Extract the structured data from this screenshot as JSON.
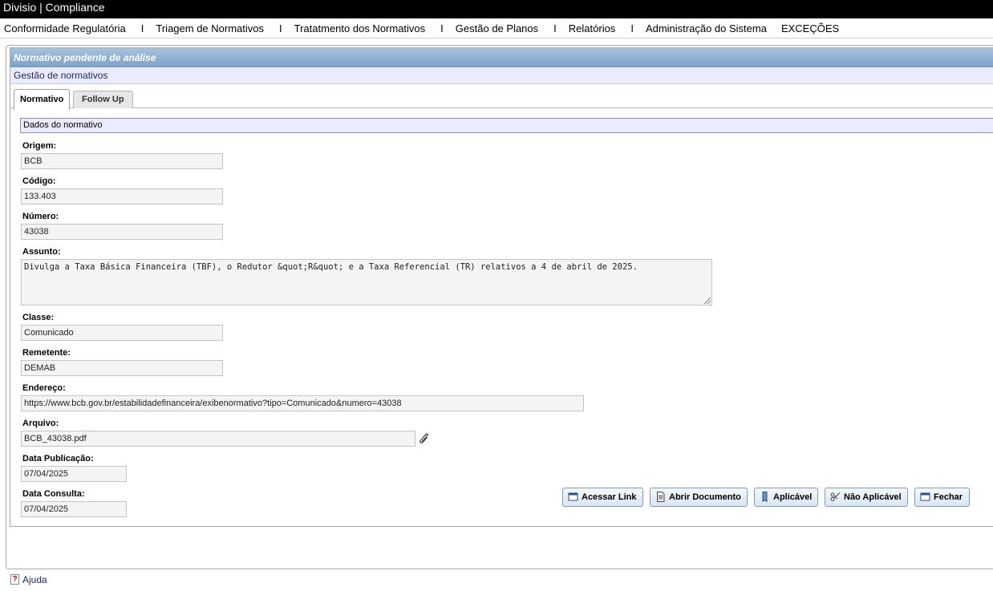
{
  "app": {
    "title": "Divisio | Compliance"
  },
  "menu": {
    "items": [
      "Conformidade Regulatória",
      "Triagem de Normativos",
      "Tratatmento dos Normativos",
      "Gestão de Planos",
      "Relatórios",
      "Administração do Sistema",
      "EXCEÇÕES"
    ],
    "separator": "I"
  },
  "panel": {
    "title": "Normativo pendente de análise",
    "subtitle": "Gestão de normativos"
  },
  "tabs": [
    {
      "label": "Normativo",
      "active": true
    },
    {
      "label": "Follow Up",
      "active": false
    }
  ],
  "section": {
    "title": "Dados do normativo"
  },
  "form": {
    "origem": {
      "label": "Origem:",
      "value": "BCB"
    },
    "codigo": {
      "label": "Código:",
      "value": "133.403"
    },
    "numero": {
      "label": "Número:",
      "value": "43038"
    },
    "assunto": {
      "label": "Assunto:",
      "value": "Divulga a Taxa Básica Financeira (TBF), o Redutor &quot;R&quot; e a Taxa Referencial (TR) relativos a 4 de abril de 2025."
    },
    "classe": {
      "label": "Classe:",
      "value": "Comunicado"
    },
    "remetente": {
      "label": "Remetente:",
      "value": "DEMAB"
    },
    "endereco": {
      "label": "Endereço:",
      "value": "https://www.bcb.gov.br/estabilidadefinanceira/exibenormativo?tipo=Comunicado&numero=43038"
    },
    "arquivo": {
      "label": "Arquivo:",
      "value": "BCB_43038.pdf",
      "icon": "paperclip-icon"
    },
    "data_publicacao": {
      "label": "Data Publicação:",
      "value": "07/04/2025"
    },
    "data_consulta": {
      "label": "Data Consulta:",
      "value": "07/04/2025"
    }
  },
  "buttons": {
    "acessar_link": {
      "label": "Acessar Link",
      "icon": "window-icon"
    },
    "abrir_documento": {
      "label": "Abrir Documento",
      "icon": "document-icon"
    },
    "aplicavel": {
      "label": "Aplicável",
      "icon": "bookmark-icon"
    },
    "nao_aplicavel": {
      "label": "Não Aplicável",
      "icon": "scissors-icon"
    },
    "fechar": {
      "label": "Fechar",
      "icon": "window-icon"
    }
  },
  "help": {
    "label": "Ajuda",
    "icon": "help-icon"
  },
  "colors": {
    "header_gradient_top": "#a7c2de",
    "header_gradient_bottom": "#7ea2c8",
    "subheader_bg": "#ebebff",
    "button_border": "#7a9cc4"
  }
}
